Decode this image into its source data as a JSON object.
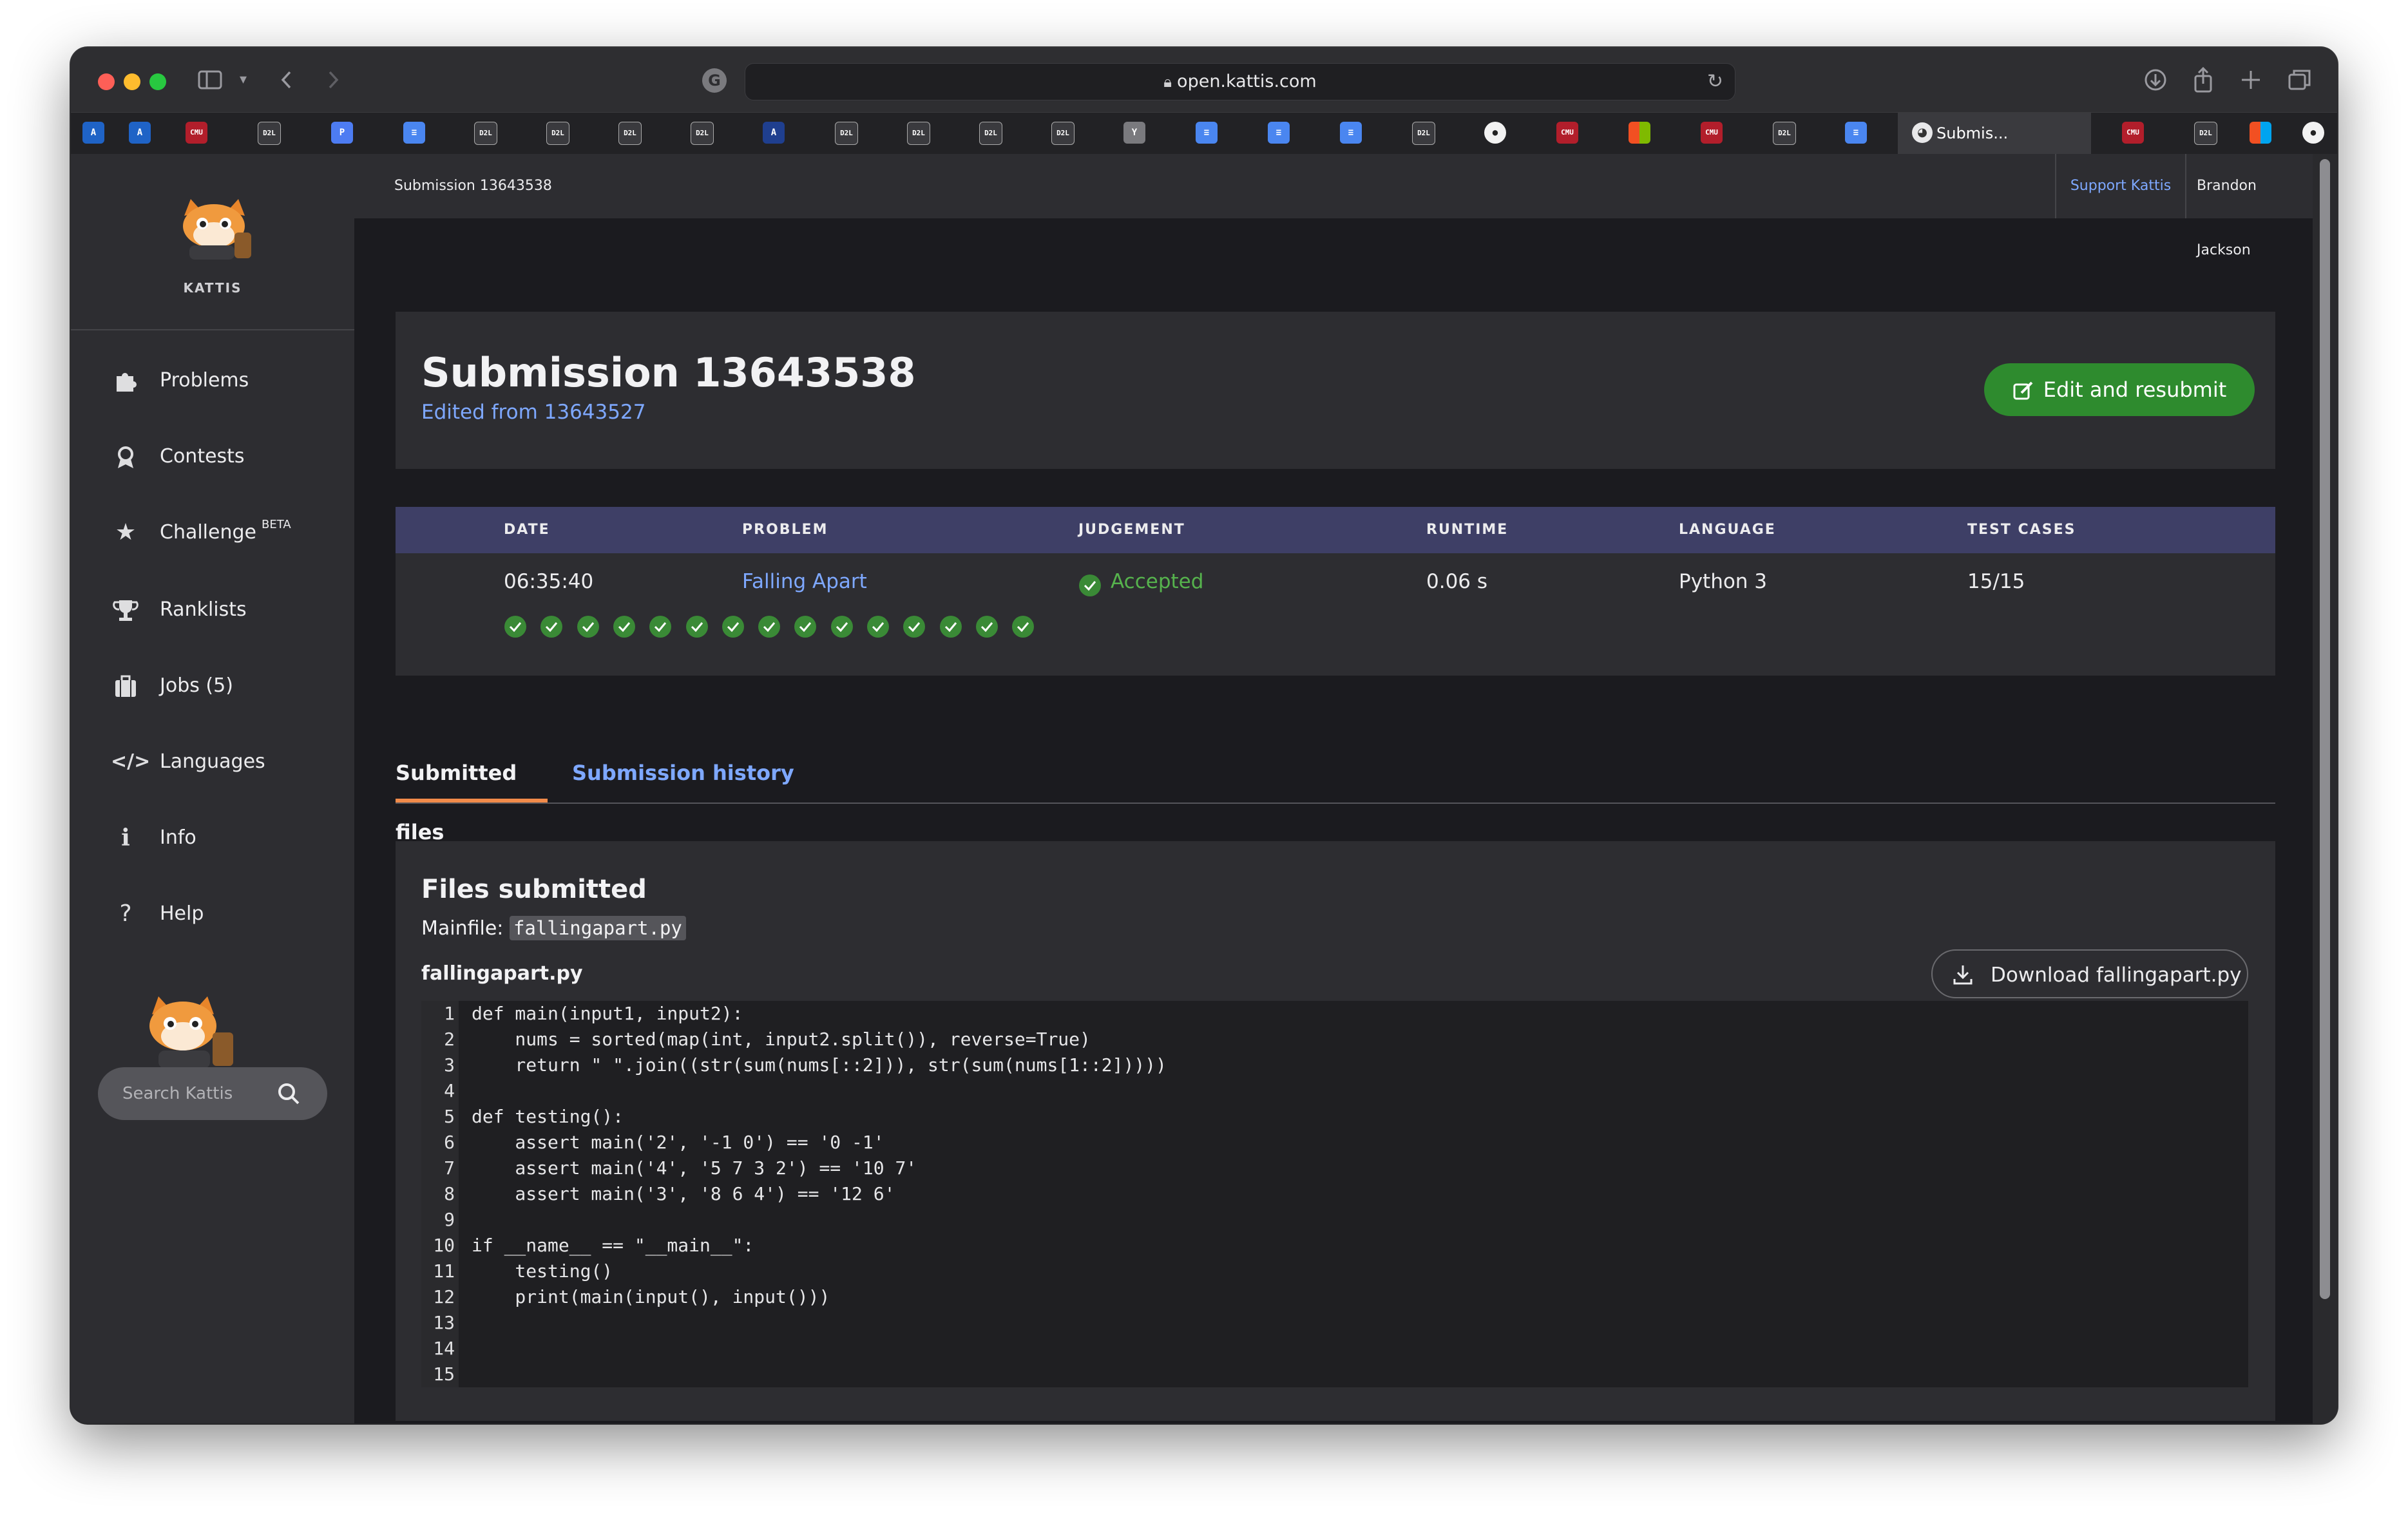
{
  "browser": {
    "url": "open.kattis.com",
    "active_tab_title": "Submis..."
  },
  "sidebar": {
    "logo_text": "KATTIS",
    "items": [
      {
        "label": "Problems",
        "icon": "puzzle-icon"
      },
      {
        "label": "Contests",
        "icon": "award-icon"
      },
      {
        "label": "Challenge",
        "icon": "star-icon",
        "badge": "BETA"
      },
      {
        "label": "Ranklists",
        "icon": "trophy-icon"
      },
      {
        "label": "Jobs (5)",
        "icon": "briefcase-icon"
      },
      {
        "label": "Languages",
        "icon": "code-icon"
      },
      {
        "label": "Info",
        "icon": "info-icon"
      },
      {
        "label": "Help",
        "icon": "help-icon"
      }
    ],
    "search_placeholder": "Search Kattis"
  },
  "topbar": {
    "breadcrumb": "Submission 13643538",
    "support": "Support Kattis",
    "user": "Brandon Jackson"
  },
  "header": {
    "title": "Submission 13643538",
    "edited_from": "Edited from 13643527",
    "resubmit_label": "Edit and resubmit"
  },
  "details": {
    "columns": [
      "DATE",
      "PROBLEM",
      "JUDGEMENT",
      "RUNTIME",
      "LANGUAGE",
      "TEST CASES"
    ],
    "row": {
      "date": "06:35:40",
      "problem": "Falling Apart",
      "judgement": "Accepted",
      "runtime": "0.06 s",
      "language": "Python 3",
      "test_cases": "15/15"
    },
    "test_case_results": [
      "accepted",
      "accepted",
      "accepted",
      "accepted",
      "accepted",
      "accepted",
      "accepted",
      "accepted",
      "accepted",
      "accepted",
      "accepted",
      "accepted",
      "accepted",
      "accepted",
      "accepted"
    ]
  },
  "tabs": {
    "active": "Submitted files",
    "other": "Submission history"
  },
  "files": {
    "title": "Files submitted",
    "mainfile_label": "Mainfile:",
    "mainfile": "fallingapart.py",
    "filename": "fallingapart.py",
    "download_label": "Download fallingapart.py",
    "lines": [
      "def main(input1, input2):",
      "    nums = sorted(map(int, input2.split()), reverse=True)",
      "    return \" \".join((str(sum(nums[::2])), str(sum(nums[1::2]))))",
      "",
      "def testing():",
      "    assert main('2', '-1 0') == '0 -1'",
      "    assert main('4', '5 7 3 2') == '10 7'",
      "    assert main('3', '8 6 4') == '12 6'",
      "",
      "if __name__ == \"__main__\":",
      "    testing()",
      "    print(main(input(), input()))",
      "",
      "",
      ""
    ],
    "line_numbers": [
      "1",
      "2",
      "3",
      "4",
      "5",
      "6",
      "7",
      "8",
      "9",
      "10",
      "11",
      "12",
      "13",
      "14",
      "15"
    ]
  },
  "colors": {
    "accent_link": "#7ea8ff",
    "accepted": "#56b34d",
    "resubmit_button": "#2e8b2e",
    "table_header": "#3e3f66",
    "active_tab_underline": "#f28b4a"
  }
}
